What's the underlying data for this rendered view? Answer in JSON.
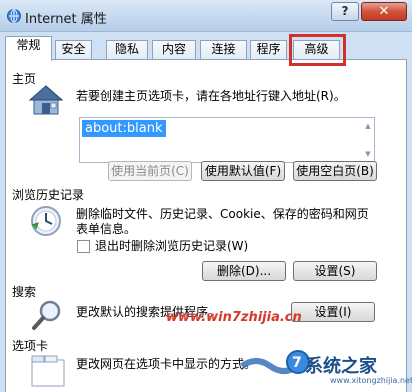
{
  "window": {
    "title": "Internet 属性",
    "help_label": "?",
    "close_label": "✕"
  },
  "tabs": [
    {
      "label": "常规",
      "active": true
    },
    {
      "label": "安全",
      "active": false
    },
    {
      "label": "隐私",
      "active": false
    },
    {
      "label": "内容",
      "active": false
    },
    {
      "label": "连接",
      "active": false
    },
    {
      "label": "程序",
      "active": false
    },
    {
      "label": "高级",
      "active": false,
      "highlighted": true
    }
  ],
  "home": {
    "section_title": "主页",
    "description": "若要创建主页选项卡，请在各地址行键入地址(R)。",
    "value": "about:blank",
    "btn_current": "使用当前页(C)",
    "btn_default": "使用默认值(F)",
    "btn_blank": "使用空白页(B)"
  },
  "history": {
    "section_title": "浏览历史记录",
    "description_line1": "删除临时文件、历史记录、Cookie、保存的密码和网页",
    "description_line2": "表单信息。",
    "checkbox_label": "退出时删除浏览历史记录(W)",
    "btn_delete": "删除(D)...",
    "btn_settings": "设置(S)"
  },
  "search": {
    "section_title": "搜索",
    "description": "更改默认的搜索提供程序。",
    "btn_settings": "设置(I)"
  },
  "tabs_section": {
    "section_title": "选项卡",
    "description": "更改网页在选项卡中显示的方式。"
  },
  "watermark": {
    "text": "www.win7zhijia.cn",
    "logo_text": "系统之家",
    "logo_url": "www.xitongzhijia.net"
  },
  "colors": {
    "highlight_box": "#d0312d",
    "selection": "#3399ff",
    "close_button": "#c23a24"
  }
}
